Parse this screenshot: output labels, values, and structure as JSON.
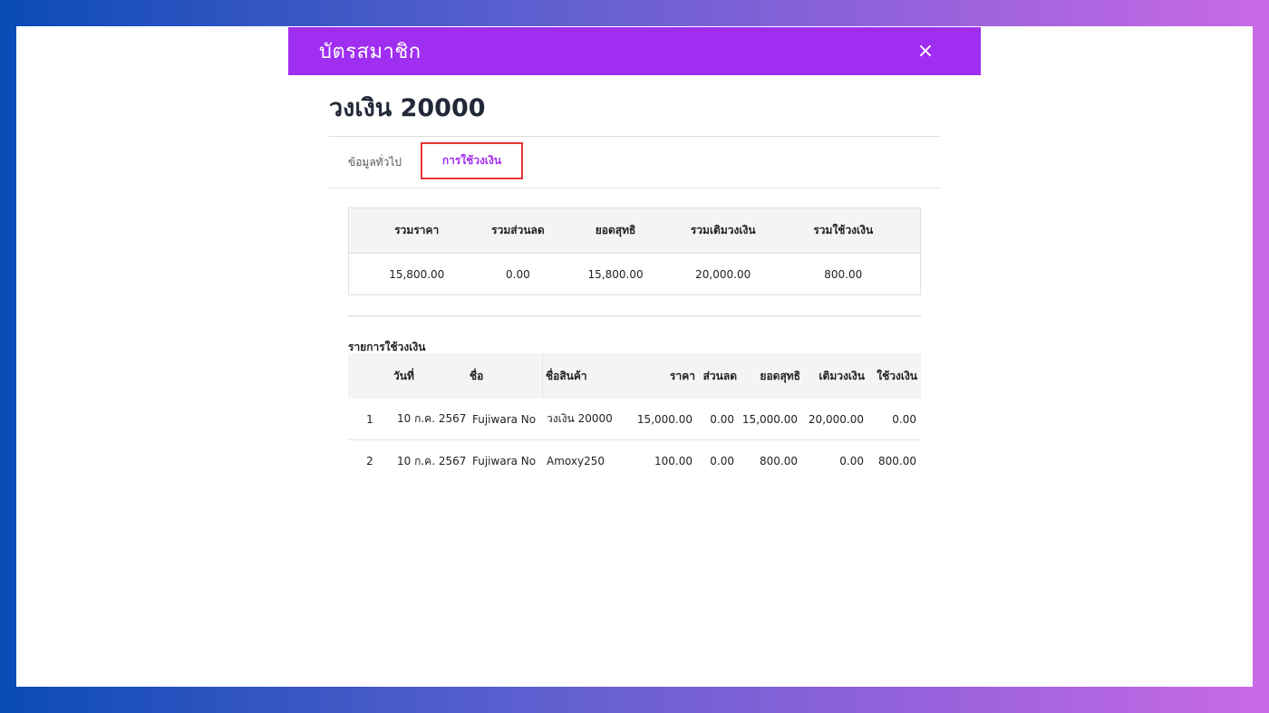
{
  "modal": {
    "title": "บัตรสมาชิก",
    "close_label": "×"
  },
  "card": {
    "title": "วงเงิน 20000"
  },
  "tabs": [
    {
      "label": "ข้อมูลทั่วไป",
      "active": false
    },
    {
      "label": "การใช้วงเงิน",
      "active": true
    }
  ],
  "summary": {
    "headers": [
      "รวมราคา",
      "รวมส่วนลด",
      "ยอดสุทธิ",
      "รวมเติมวงเงิน",
      "รวมใช้วงเงิน"
    ],
    "values": [
      "15,800.00",
      "0.00",
      "15,800.00",
      "20,000.00",
      "800.00"
    ]
  },
  "transactions": {
    "label": "รายการใช้วงเงิน",
    "headers": [
      "",
      "วันที่",
      "ชื่อ",
      "ชื่อสินค้า",
      "ราคา",
      "ส่วนลด",
      "ยอดสุทธิ",
      "เติมวงเงิน",
      "ใช้วงเงิน"
    ],
    "rows": [
      [
        "1",
        "10 ก.ค. 2567",
        "Fujiwara No",
        "วงเงิน 20000",
        "15,000.00",
        "0.00",
        "15,000.00",
        "20,000.00",
        "0.00"
      ],
      [
        "2",
        "10 ก.ค. 2567",
        "Fujiwara No",
        "Amoxy250",
        "100.00",
        "0.00",
        "800.00",
        "0.00",
        "800.00"
      ]
    ]
  },
  "colors": {
    "header_bg": "#a02ef0",
    "active_tab_text": "#a02ef0",
    "highlight_border": "#e53535"
  }
}
